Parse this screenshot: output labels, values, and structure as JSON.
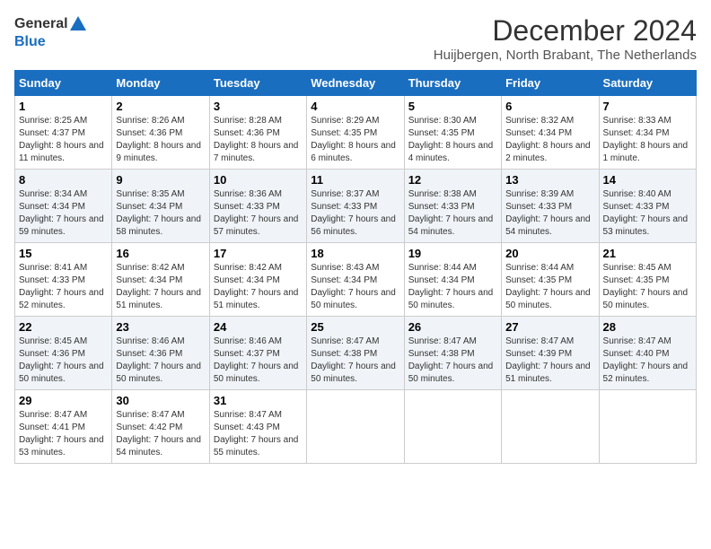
{
  "logo": {
    "general": "General",
    "blue": "Blue"
  },
  "title": "December 2024",
  "subtitle": "Huijbergen, North Brabant, The Netherlands",
  "weekdays": [
    "Sunday",
    "Monday",
    "Tuesday",
    "Wednesday",
    "Thursday",
    "Friday",
    "Saturday"
  ],
  "weeks": [
    [
      {
        "day": "1",
        "sunrise": "8:25 AM",
        "sunset": "4:37 PM",
        "daylight": "8 hours and 11 minutes."
      },
      {
        "day": "2",
        "sunrise": "8:26 AM",
        "sunset": "4:36 PM",
        "daylight": "8 hours and 9 minutes."
      },
      {
        "day": "3",
        "sunrise": "8:28 AM",
        "sunset": "4:36 PM",
        "daylight": "8 hours and 7 minutes."
      },
      {
        "day": "4",
        "sunrise": "8:29 AM",
        "sunset": "4:35 PM",
        "daylight": "8 hours and 6 minutes."
      },
      {
        "day": "5",
        "sunrise": "8:30 AM",
        "sunset": "4:35 PM",
        "daylight": "8 hours and 4 minutes."
      },
      {
        "day": "6",
        "sunrise": "8:32 AM",
        "sunset": "4:34 PM",
        "daylight": "8 hours and 2 minutes."
      },
      {
        "day": "7",
        "sunrise": "8:33 AM",
        "sunset": "4:34 PM",
        "daylight": "8 hours and 1 minute."
      }
    ],
    [
      {
        "day": "8",
        "sunrise": "8:34 AM",
        "sunset": "4:34 PM",
        "daylight": "7 hours and 59 minutes."
      },
      {
        "day": "9",
        "sunrise": "8:35 AM",
        "sunset": "4:34 PM",
        "daylight": "7 hours and 58 minutes."
      },
      {
        "day": "10",
        "sunrise": "8:36 AM",
        "sunset": "4:33 PM",
        "daylight": "7 hours and 57 minutes."
      },
      {
        "day": "11",
        "sunrise": "8:37 AM",
        "sunset": "4:33 PM",
        "daylight": "7 hours and 56 minutes."
      },
      {
        "day": "12",
        "sunrise": "8:38 AM",
        "sunset": "4:33 PM",
        "daylight": "7 hours and 54 minutes."
      },
      {
        "day": "13",
        "sunrise": "8:39 AM",
        "sunset": "4:33 PM",
        "daylight": "7 hours and 54 minutes."
      },
      {
        "day": "14",
        "sunrise": "8:40 AM",
        "sunset": "4:33 PM",
        "daylight": "7 hours and 53 minutes."
      }
    ],
    [
      {
        "day": "15",
        "sunrise": "8:41 AM",
        "sunset": "4:33 PM",
        "daylight": "7 hours and 52 minutes."
      },
      {
        "day": "16",
        "sunrise": "8:42 AM",
        "sunset": "4:34 PM",
        "daylight": "7 hours and 51 minutes."
      },
      {
        "day": "17",
        "sunrise": "8:42 AM",
        "sunset": "4:34 PM",
        "daylight": "7 hours and 51 minutes."
      },
      {
        "day": "18",
        "sunrise": "8:43 AM",
        "sunset": "4:34 PM",
        "daylight": "7 hours and 50 minutes."
      },
      {
        "day": "19",
        "sunrise": "8:44 AM",
        "sunset": "4:34 PM",
        "daylight": "7 hours and 50 minutes."
      },
      {
        "day": "20",
        "sunrise": "8:44 AM",
        "sunset": "4:35 PM",
        "daylight": "7 hours and 50 minutes."
      },
      {
        "day": "21",
        "sunrise": "8:45 AM",
        "sunset": "4:35 PM",
        "daylight": "7 hours and 50 minutes."
      }
    ],
    [
      {
        "day": "22",
        "sunrise": "8:45 AM",
        "sunset": "4:36 PM",
        "daylight": "7 hours and 50 minutes."
      },
      {
        "day": "23",
        "sunrise": "8:46 AM",
        "sunset": "4:36 PM",
        "daylight": "7 hours and 50 minutes."
      },
      {
        "day": "24",
        "sunrise": "8:46 AM",
        "sunset": "4:37 PM",
        "daylight": "7 hours and 50 minutes."
      },
      {
        "day": "25",
        "sunrise": "8:47 AM",
        "sunset": "4:38 PM",
        "daylight": "7 hours and 50 minutes."
      },
      {
        "day": "26",
        "sunrise": "8:47 AM",
        "sunset": "4:38 PM",
        "daylight": "7 hours and 50 minutes."
      },
      {
        "day": "27",
        "sunrise": "8:47 AM",
        "sunset": "4:39 PM",
        "daylight": "7 hours and 51 minutes."
      },
      {
        "day": "28",
        "sunrise": "8:47 AM",
        "sunset": "4:40 PM",
        "daylight": "7 hours and 52 minutes."
      }
    ],
    [
      {
        "day": "29",
        "sunrise": "8:47 AM",
        "sunset": "4:41 PM",
        "daylight": "7 hours and 53 minutes."
      },
      {
        "day": "30",
        "sunrise": "8:47 AM",
        "sunset": "4:42 PM",
        "daylight": "7 hours and 54 minutes."
      },
      {
        "day": "31",
        "sunrise": "8:47 AM",
        "sunset": "4:43 PM",
        "daylight": "7 hours and 55 minutes."
      },
      null,
      null,
      null,
      null
    ]
  ]
}
